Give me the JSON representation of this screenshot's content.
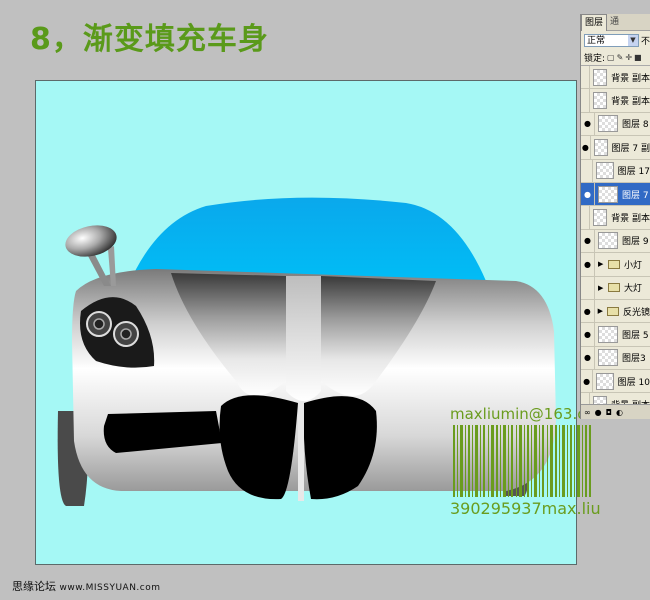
{
  "title": "8，渐变填充车身",
  "watermark": {
    "email": "maxliumin@163.com",
    "code": "390295937max.liu"
  },
  "footer": {
    "site_name": "思缘论坛",
    "site_url": "www.MISSYUAN.com"
  },
  "layers_panel": {
    "tab_layers": "图层",
    "tab_other": "通",
    "blend_mode": "正常",
    "opacity_label_partial": "不",
    "lock_label": "锁定:",
    "layers": [
      {
        "name": "背景 副本",
        "visible": false,
        "selected": false,
        "type": "layer"
      },
      {
        "name": "背景 副本",
        "visible": false,
        "selected": false,
        "type": "layer"
      },
      {
        "name": "图层 8",
        "visible": true,
        "selected": false,
        "type": "layer"
      },
      {
        "name": "图层 7 副",
        "visible": true,
        "selected": false,
        "type": "layer"
      },
      {
        "name": "图层 17",
        "visible": false,
        "selected": false,
        "type": "layer"
      },
      {
        "name": "图层 7",
        "visible": true,
        "selected": true,
        "type": "layer"
      },
      {
        "name": "背景 副本",
        "visible": false,
        "selected": false,
        "type": "layer"
      },
      {
        "name": "图层 9",
        "visible": true,
        "selected": false,
        "type": "layer"
      },
      {
        "name": "小灯",
        "visible": true,
        "selected": false,
        "type": "group"
      },
      {
        "name": "大灯",
        "visible": false,
        "selected": false,
        "type": "group"
      },
      {
        "name": "反光镜",
        "visible": true,
        "selected": false,
        "type": "group"
      },
      {
        "name": "图层 5",
        "visible": true,
        "selected": false,
        "type": "layer"
      },
      {
        "name": "图层3",
        "visible": true,
        "selected": false,
        "type": "layer"
      },
      {
        "name": "图层 10",
        "visible": true,
        "selected": false,
        "type": "layer"
      },
      {
        "name": "背景 副本",
        "visible": false,
        "selected": false,
        "type": "layer"
      }
    ]
  },
  "colors": {
    "canvas_bg": "#a5f8f5",
    "windshield": "#05b5f0",
    "title_green": "#5a9a1a",
    "watermark_green": "#6a9c1e",
    "selected_layer": "#316ac5"
  }
}
